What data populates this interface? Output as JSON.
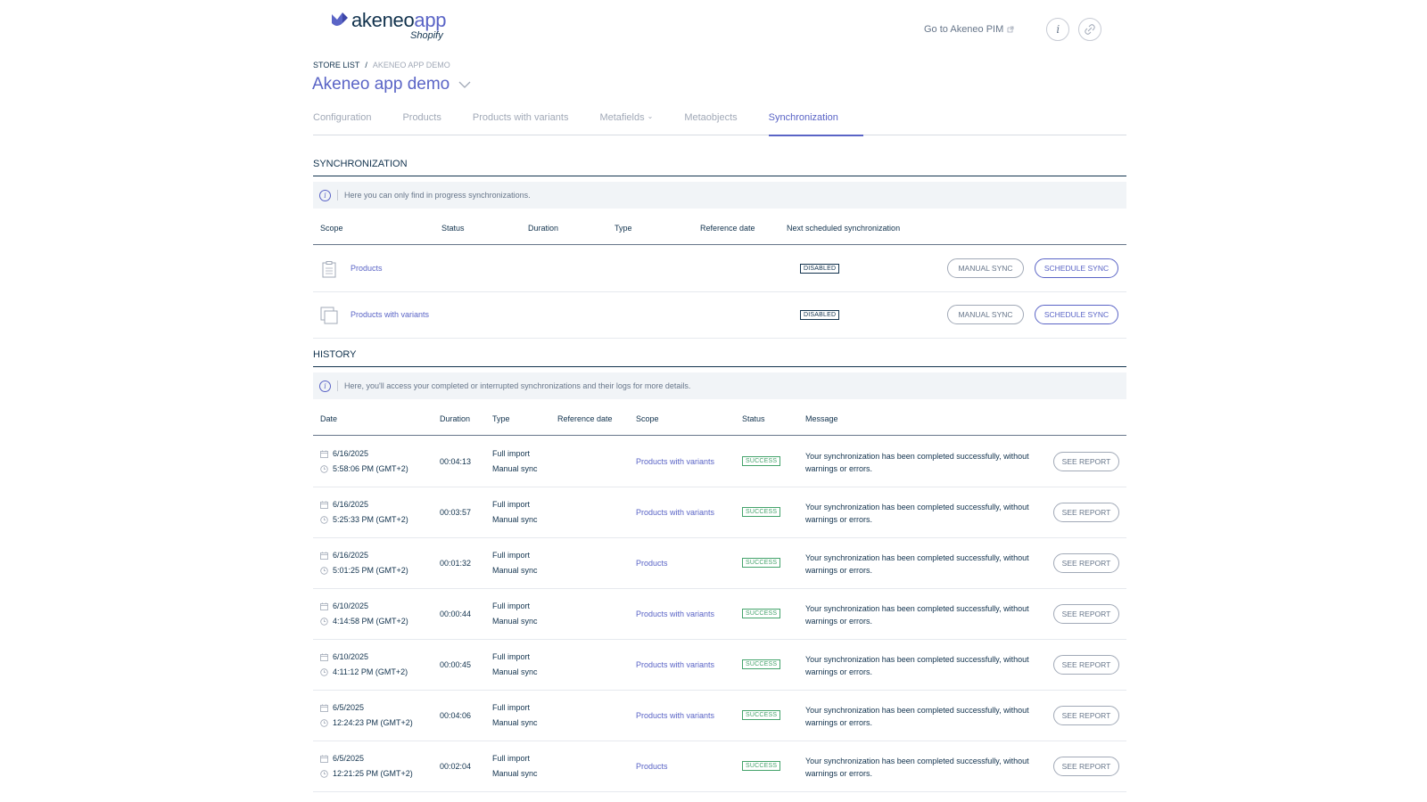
{
  "brand": {
    "name_main": "akeneo",
    "name_app": "app",
    "sub": "Shopify"
  },
  "header": {
    "goto_label": "Go to Akeneo PIM"
  },
  "breadcrumb": {
    "root": "STORE LIST",
    "separator": "/",
    "current": "AKENEO APP DEMO"
  },
  "page_title": "Akeneo app demo",
  "tabs": [
    {
      "label": "Configuration"
    },
    {
      "label": "Products"
    },
    {
      "label": "Products with variants"
    },
    {
      "label": "Metafields"
    },
    {
      "label": "Metaobjects"
    },
    {
      "label": "Synchronization"
    }
  ],
  "active_tab": "Synchronization",
  "sync": {
    "title": "SYNCHRONIZATION",
    "info": "Here you can only find in progress synchronizations.",
    "columns": [
      "Scope",
      "Status",
      "Duration",
      "Type",
      "Reference date",
      "Next scheduled synchronization"
    ],
    "rows": [
      {
        "scope": "Products",
        "icon": "clipboard-icon",
        "next": "DISABLED",
        "manual": "MANUAL SYNC",
        "schedule": "SCHEDULE SYNC"
      },
      {
        "scope": "Products with variants",
        "icon": "stacked-squares-icon",
        "next": "DISABLED",
        "manual": "MANUAL SYNC",
        "schedule": "SCHEDULE SYNC"
      }
    ]
  },
  "history": {
    "title": "HISTORY",
    "info": "Here, you'll access your completed or interrupted synchronizations and their logs for more details.",
    "columns": [
      "Date",
      "Duration",
      "Type",
      "Reference date",
      "Scope",
      "Status",
      "Message"
    ],
    "rows": [
      {
        "date": "6/16/2025",
        "time": "5:58:06 PM (GMT+2)",
        "duration": "00:04:13",
        "type": "Full import",
        "mode": "Manual sync",
        "scope": "Products with variants",
        "status": "SUCCESS",
        "message": "Your synchronization has been completed successfully, without warnings or errors.",
        "action": "SEE REPORT"
      },
      {
        "date": "6/16/2025",
        "time": "5:25:33 PM (GMT+2)",
        "duration": "00:03:57",
        "type": "Full import",
        "mode": "Manual sync",
        "scope": "Products with variants",
        "status": "SUCCESS",
        "message": "Your synchronization has been completed successfully, without warnings or errors.",
        "action": "SEE REPORT"
      },
      {
        "date": "6/16/2025",
        "time": "5:01:25 PM (GMT+2)",
        "duration": "00:01:32",
        "type": "Full import",
        "mode": "Manual sync",
        "scope": "Products",
        "status": "SUCCESS",
        "message": "Your synchronization has been completed successfully, without warnings or errors.",
        "action": "SEE REPORT"
      },
      {
        "date": "6/10/2025",
        "time": "4:14:58 PM (GMT+2)",
        "duration": "00:00:44",
        "type": "Full import",
        "mode": "Manual sync",
        "scope": "Products with variants",
        "status": "SUCCESS",
        "message": "Your synchronization has been completed successfully, without warnings or errors.",
        "action": "SEE REPORT"
      },
      {
        "date": "6/10/2025",
        "time": "4:11:12 PM (GMT+2)",
        "duration": "00:00:45",
        "type": "Full import",
        "mode": "Manual sync",
        "scope": "Products with variants",
        "status": "SUCCESS",
        "message": "Your synchronization has been completed successfully, without warnings or errors.",
        "action": "SEE REPORT"
      },
      {
        "date": "6/5/2025",
        "time": "12:24:23 PM (GMT+2)",
        "duration": "00:04:06",
        "type": "Full import",
        "mode": "Manual sync",
        "scope": "Products with variants",
        "status": "SUCCESS",
        "message": "Your synchronization has been completed successfully, without warnings or errors.",
        "action": "SEE REPORT"
      },
      {
        "date": "6/5/2025",
        "time": "12:21:25 PM (GMT+2)",
        "duration": "00:02:04",
        "type": "Full import",
        "mode": "Manual sync",
        "scope": "Products",
        "status": "SUCCESS",
        "message": "Your synchronization has been completed successfully, without warnings or errors.",
        "action": "SEE REPORT"
      }
    ]
  },
  "colors": {
    "accent": "#5a64c6",
    "text": "#11324d",
    "muted": "#a1a9b7",
    "success": "#44a36b",
    "info_bg": "#f1f4f7"
  }
}
